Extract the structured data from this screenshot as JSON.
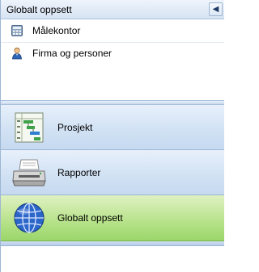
{
  "header": {
    "title": "Globalt oppsett",
    "collapse_icon": "chevron-left-icon"
  },
  "nav_items": [
    {
      "label": "Målekontor",
      "icon": "calculator-icon"
    },
    {
      "label": "Firma og personer",
      "icon": "person-icon"
    }
  ],
  "modules": [
    {
      "label": "Prosjekt",
      "icon": "gantt-chart-icon"
    },
    {
      "label": "Rapporter",
      "icon": "printer-icon"
    },
    {
      "label": "Globalt oppsett",
      "icon": "globe-icon",
      "active": true
    }
  ],
  "colors": {
    "active_module": "#a8dc7a",
    "header": "#dbe7f4",
    "module": "#d2e2f4"
  }
}
